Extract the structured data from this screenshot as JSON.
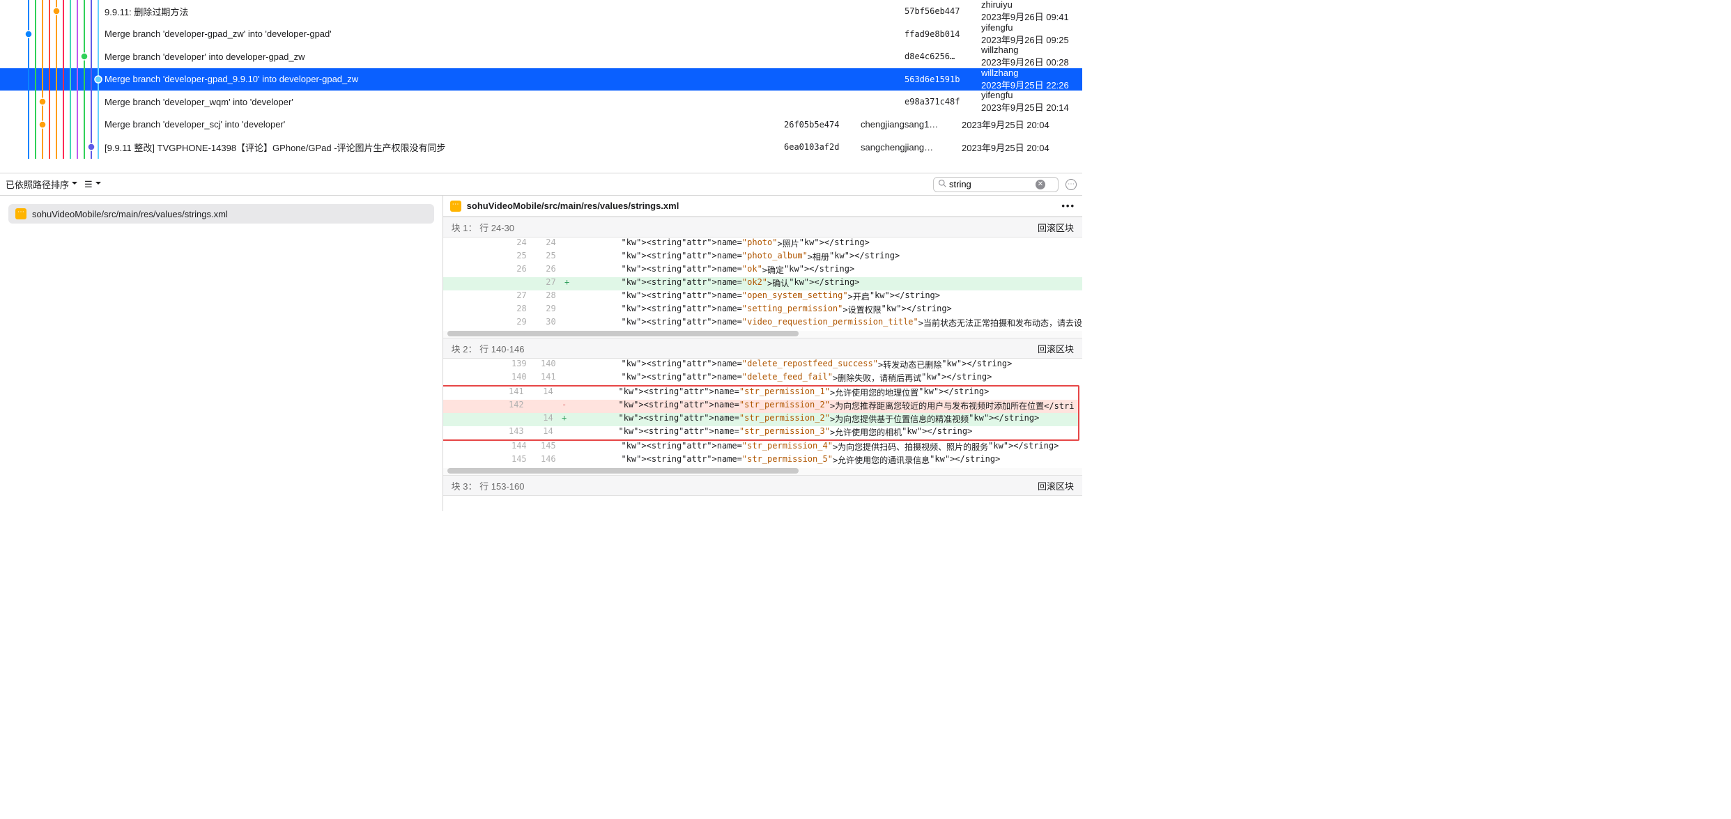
{
  "commits": [
    {
      "message": "9.9.11: 删除过期方法",
      "hash": "57bf56eb447",
      "author": "zhiruiyu <zhiruiy…",
      "date": "2023年9月26日 09:41",
      "selected": false,
      "dotColor": "#ff9f0a",
      "dotX": 81
    },
    {
      "message": "Merge branch 'developer-gpad_zw' into 'developer-gpad'",
      "hash": "ffad9e8b014",
      "author": "yifengfu <yifengf…",
      "date": "2023年9月26日 09:25",
      "selected": false,
      "dotColor": "#0a84ff",
      "dotX": 41
    },
    {
      "message": "Merge branch 'developer' into developer-gpad_zw",
      "hash": "d8e4c6256…",
      "author": "willzhang <willzh…",
      "date": "2023年9月26日 00:28",
      "selected": false,
      "dotColor": "#30d158",
      "dotX": 121
    },
    {
      "message": "Merge branch 'developer-gpad_9.9.10' into developer-gpad_zw",
      "hash": "563d6e1591b",
      "author": "willzhang <willzh…",
      "date": "2023年9月25日 22:26",
      "selected": true,
      "dotColor": "#64d2ff",
      "dotX": 141
    },
    {
      "message": "Merge branch 'developer_wqm' into 'developer'",
      "hash": "e98a371c48f",
      "author": "yifengfu <yifengf…",
      "date": "2023年9月25日 20:14",
      "selected": false,
      "dotColor": "#ff9f0a",
      "dotX": 61
    },
    {
      "message": "Merge branch 'developer_scj' into 'developer'",
      "hash": "26f05b5e474",
      "author": "chengjiangsang1…",
      "date": "2023年9月25日 20:04",
      "selected": false,
      "dotColor": "#ff9f0a",
      "dotX": 61
    },
    {
      "message": "[9.9.11 整改] TVGPHONE-14398【评论】GPhone/GPad -评论图片生产权限没有同步",
      "hash": "6ea0103af2d",
      "author": "sangchengjiang…",
      "date": "2023年9月25日 20:04",
      "selected": false,
      "dotColor": "#5e5ce6",
      "dotX": 131
    }
  ],
  "graph": {
    "laneX": [
      41,
      51,
      61,
      71,
      81,
      91,
      101,
      111,
      121,
      131,
      141
    ],
    "colors": [
      "#0a84ff",
      "#30d158",
      "#ff9f0a",
      "#ff453a",
      "#ff9f0a",
      "#ff2d55",
      "#44d7b6",
      "#bf5af2",
      "#30d158",
      "#5e5ce6",
      "#64d2ff"
    ]
  },
  "toolbar": {
    "sort_label": "已依照路径排序",
    "search_value": "string"
  },
  "left_file": {
    "path": "sohuVideoMobile/src/main/res/values/strings.xml"
  },
  "right_file": {
    "path": "sohuVideoMobile/src/main/res/values/strings.xml"
  },
  "hunks": [
    {
      "header": "块 1：  行 24-30",
      "rollback": "回滚区块",
      "lines": [
        {
          "l": "24",
          "r": "24",
          "t": " ",
          "code": "        <string name=\"photo\">照片</string>"
        },
        {
          "l": "25",
          "r": "25",
          "t": " ",
          "code": "        <string name=\"photo_album\">相册</string>"
        },
        {
          "l": "26",
          "r": "26",
          "t": " ",
          "code": "        <string name=\"ok\">确定</string>"
        },
        {
          "l": "",
          "r": "27",
          "t": "+",
          "code": "        <string name=\"ok2\">确认</string>"
        },
        {
          "l": "27",
          "r": "28",
          "t": " ",
          "code": "        <string name=\"open_system_setting\">开启</string>"
        },
        {
          "l": "28",
          "r": "29",
          "t": " ",
          "code": "        <string name=\"setting_permission\">设置权限</string>"
        },
        {
          "l": "29",
          "r": "30",
          "t": " ",
          "code": "        <string name=\"video_requestion_permission_title\">当前状态无法正常拍摄和发布动态，请去设"
        }
      ]
    },
    {
      "header": "块 2：  行 140-146",
      "rollback": "回滚区块",
      "boxed": true,
      "lines": [
        {
          "l": "139",
          "r": "140",
          "t": " ",
          "code": "        <string name=\"delete_repostfeed_success\">转发动态已删除</string>"
        },
        {
          "l": "140",
          "r": "141",
          "t": " ",
          "code": "        <string name=\"delete_feed_fail\">删除失败，请稍后再试</string>"
        },
        {
          "l": "141",
          "r": "14",
          "t": " ",
          "code": "        <string name=\"str_permission_1\">允许使用您的地理位置</string>",
          "inBox": true
        },
        {
          "l": "142",
          "r": "",
          "t": "-",
          "code": "        <string name=\"str_permission_2\">为向您推荐距离您较近的用户与发布视频时添加所在位置</stri",
          "inBox": true
        },
        {
          "l": "",
          "r": "14",
          "t": "+",
          "code": "        <string name=\"str_permission_2\">为向您提供基于位置信息的精准视频</string>",
          "inBox": true
        },
        {
          "l": "143",
          "r": "14",
          "t": " ",
          "code": "        <string name=\"str_permission_3\">允许使用您的相机</string>",
          "inBox": true
        },
        {
          "l": "144",
          "r": "145",
          "t": " ",
          "code": "        <string name=\"str_permission_4\">为向您提供扫码、拍摄视频、照片的服务</string>"
        },
        {
          "l": "145",
          "r": "146",
          "t": " ",
          "code": "        <string name=\"str_permission_5\">允许使用您的通讯录信息</string>"
        }
      ]
    }
  ],
  "hunk3": {
    "header": "块 3：  行 153-160",
    "rollback": "回滚区块"
  }
}
